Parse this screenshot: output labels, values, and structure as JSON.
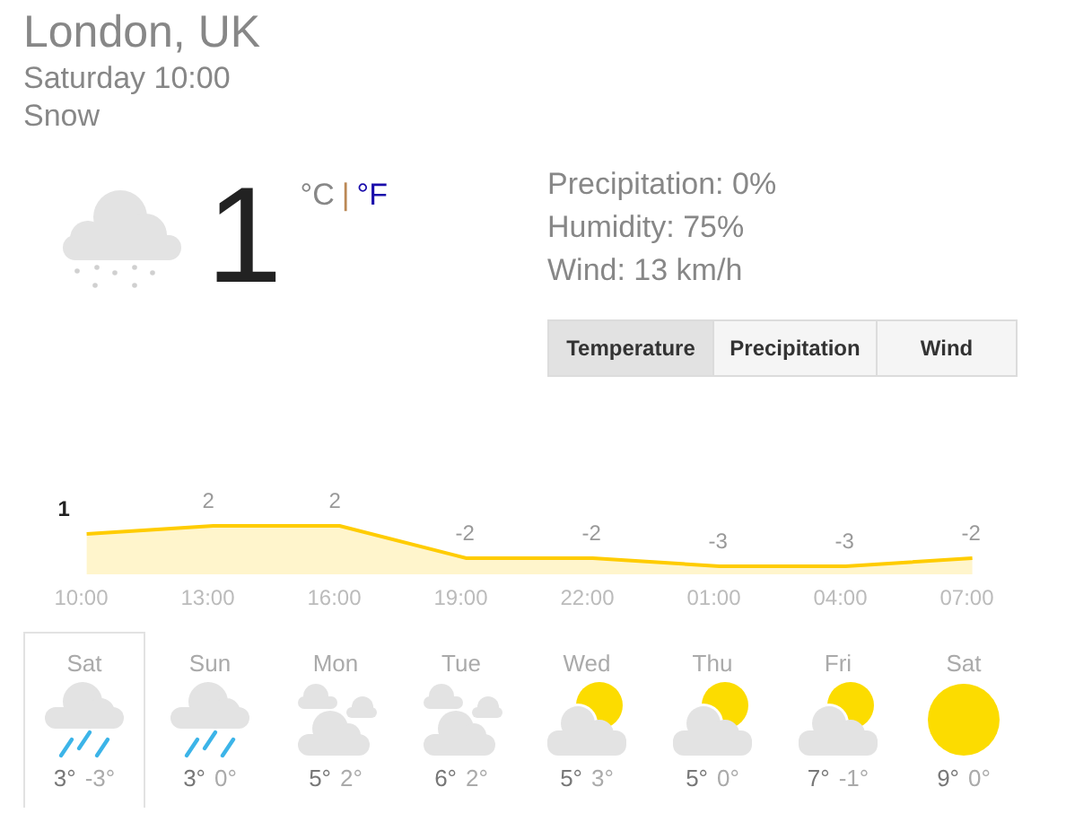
{
  "location": "London, UK",
  "datetime": "Saturday 10:00",
  "condition": "Snow",
  "current": {
    "kind": "snow",
    "temperature": "1",
    "units": [
      {
        "label": "°C",
        "selected": true
      },
      {
        "label": "°F",
        "selected": false
      }
    ],
    "separator": "|"
  },
  "details": [
    "Precipitation: 0%",
    "Humidity: 75%",
    "Wind: 13 km/h"
  ],
  "tabs": [
    {
      "label": "Temperature",
      "selected": true
    },
    {
      "label": "Precipitation",
      "selected": false
    },
    {
      "label": "Wind",
      "selected": false
    }
  ],
  "chart": {
    "chart_data": {
      "type": "area",
      "categories": [
        "10:00",
        "13:00",
        "16:00",
        "19:00",
        "22:00",
        "01:00",
        "04:00",
        "07:00"
      ],
      "series": [
        {
          "color": "#ffcc00",
          "values": [
            1,
            2,
            2,
            -2,
            -2,
            -3,
            -3,
            -2
          ]
        }
      ],
      "data_labels": true
    }
  },
  "days": [
    {
      "day": "Sat",
      "kind": "rain",
      "high": "3°",
      "low": "-3°",
      "selected": true
    },
    {
      "day": "Sun",
      "kind": "rain",
      "high": "3°",
      "low": "0°",
      "selected": false
    },
    {
      "day": "Mon",
      "kind": "cloudy",
      "high": "5°",
      "low": "2°",
      "selected": false
    },
    {
      "day": "Tue",
      "kind": "cloudy",
      "high": "6°",
      "low": "2°",
      "selected": false
    },
    {
      "day": "Wed",
      "kind": "partly_sunny",
      "high": "5°",
      "low": "3°",
      "selected": false
    },
    {
      "day": "Thu",
      "kind": "partly_sunny",
      "high": "5°",
      "low": "0°",
      "selected": false
    },
    {
      "day": "Fri",
      "kind": "partly_sunny",
      "high": "7°",
      "low": "-1°",
      "selected": false
    },
    {
      "day": "Sat",
      "kind": "sunny",
      "high": "9°",
      "low": "0°",
      "selected": false
    }
  ]
}
